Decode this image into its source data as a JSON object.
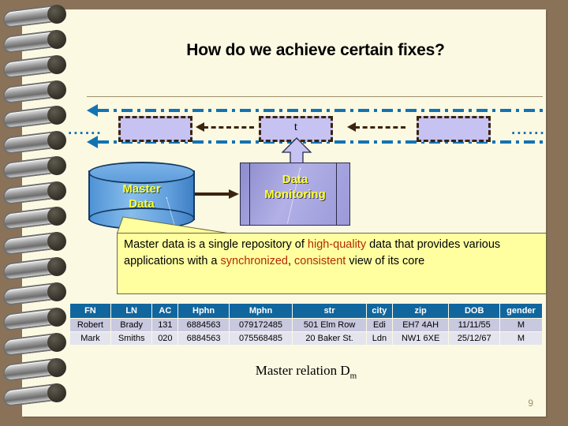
{
  "slide": {
    "title": "How do we achieve certain fixes?",
    "page_number": "9",
    "colors": {
      "page_background": "#fbf9e2",
      "border_brown": "#8a7258",
      "accent_blue": "#1273b3",
      "table_header_blue": "#11669e",
      "callout_yellow": "#ffffa0",
      "highlight_red": "#b32a00",
      "label_yellow": "#ffff2e",
      "lavender_box": "#c6c2f2",
      "dark_brown_line": "#3b2410"
    }
  },
  "diagram": {
    "left_ellipsis": "......",
    "right_ellipsis": "......",
    "tuple_label": "t",
    "cylinder_line1": "Master",
    "cylinder_line2": "Data",
    "box_line1": "Data",
    "box_line2": "Monitoring"
  },
  "callout": {
    "seg1": "Master data is a single repository of ",
    "hl1": "high-quality",
    "seg2": " data that provides various applications with a ",
    "hl2": "synchronized",
    "seg3": ", ",
    "hl3": "consistent",
    "seg4": " view of its core"
  },
  "table": {
    "headers": [
      "FN",
      "LN",
      "AC",
      "Hphn",
      "Mphn",
      "str",
      "city",
      "zip",
      "DOB",
      "gender"
    ],
    "rows": [
      [
        "Robert",
        "Brady",
        "131",
        "6884563",
        "079172485",
        "501 Elm Row",
        "Edi",
        "EH7 4AH",
        "11/11/55",
        "M"
      ],
      [
        "Mark",
        "Smiths",
        "020",
        "6884563",
        "075568485",
        "20 Baker St.",
        "Ldn",
        "NW1 6XE",
        "25/12/67",
        "M"
      ]
    ],
    "caption_text": "Master relation D",
    "caption_sub": "m"
  }
}
